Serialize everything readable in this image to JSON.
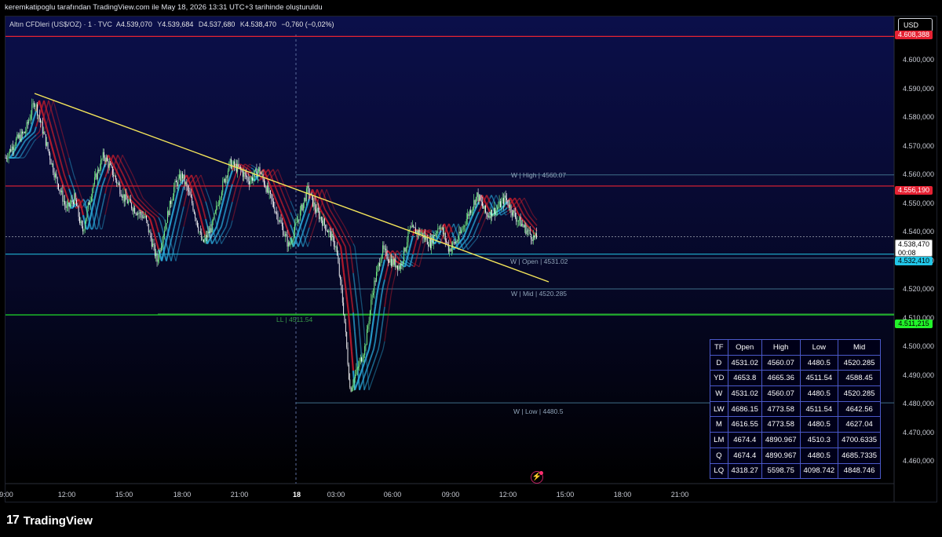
{
  "caption": "keremkatipoglu tarafından TradingView.com ile May 18, 2026 13:31 UTC+3 tarihinde oluşturuldu",
  "legend": {
    "symbol": "Altın CFDleri (US$/OZ) · 1 · TVC",
    "open_label": "A",
    "open": "4.539,070",
    "high_label": "Y",
    "high": "4.539,684",
    "low_label": "D",
    "low": "4.537,680",
    "close_label": "K",
    "close": "4.538,470",
    "change": "−0,760 (−0,02%)"
  },
  "currency_button": "USD",
  "price_axis": [
    "4.600,000",
    "4.590,000",
    "4.580,000",
    "4.570,000",
    "4.560,000",
    "4.550,000",
    "4.540,000",
    "4.530,000",
    "4.520,000",
    "4.510,000",
    "4.500,000",
    "4.490,000",
    "4.480,000",
    "4.470,000",
    "4.460,000"
  ],
  "price_tags": {
    "top_red": "4.608,388",
    "red": "4.556,190",
    "current": "4.538,470",
    "countdown": "00:08",
    "cyan": "4.532,410",
    "green": "4.511,215"
  },
  "time_axis": [
    "9:00",
    "12:00",
    "15:00",
    "18:00",
    "21:00",
    "18",
    "03:00",
    "06:00",
    "09:00",
    "12:00",
    "15:00",
    "18:00",
    "21:00"
  ],
  "levels": {
    "w_high": "W | High | 4560.07",
    "w_open": "W | Open | 4531.02",
    "w_mid": "W | Mid | 4520.285",
    "ll": "LL | 4511.54",
    "w_low": "W | Low | 4480.5"
  },
  "table": {
    "headers": [
      "TF",
      "Open",
      "High",
      "Low",
      "Mid"
    ],
    "rows": [
      [
        "D",
        "4531.02",
        "4560.07",
        "4480.5",
        "4520.285"
      ],
      [
        "YD",
        "4653.8",
        "4665.36",
        "4511.54",
        "4588.45"
      ],
      [
        "W",
        "4531.02",
        "4560.07",
        "4480.5",
        "4520.285"
      ],
      [
        "LW",
        "4686.15",
        "4773.58",
        "4511.54",
        "4642.56"
      ],
      [
        "M",
        "4616.55",
        "4773.58",
        "4480.5",
        "4627.04"
      ],
      [
        "LM",
        "4674.4",
        "4890.967",
        "4510.3",
        "4700.6335"
      ],
      [
        "Q",
        "4674.4",
        "4890.967",
        "4480.5",
        "4685.7335"
      ],
      [
        "LQ",
        "4318.27",
        "5598.75",
        "4098.742",
        "4848.746"
      ]
    ]
  },
  "brand": {
    "logo": "17",
    "name": "TradingView"
  },
  "colors": {
    "bg_top": "#0b0f4a",
    "bg_bottom": "#000000",
    "bull": "#7cfc8a",
    "bear": "#ffffff",
    "ribbon_bull": "#2aa8d8",
    "ribbon_bear": "#c21c2c",
    "trendline": "#f5e65a",
    "red_line": "#e52233",
    "green_line": "#22f22a",
    "cyan_line": "#22c7e8"
  },
  "icons": {
    "lightning": "lightning-icon"
  }
}
